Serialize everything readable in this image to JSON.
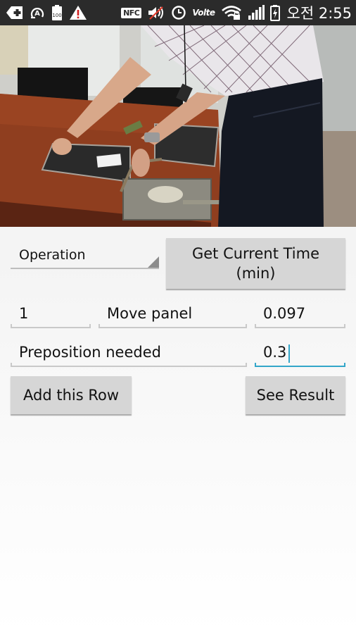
{
  "status_bar": {
    "left_icons": [
      "add-icon",
      "auto-rotate-icon",
      "battery-saver-100-icon",
      "warning-icon"
    ],
    "right_icons": [
      "nfc-icon",
      "mute-icon",
      "alarm-icon",
      "volte-icon",
      "wifi-lock-icon",
      "signal-icon",
      "charging-battery-icon"
    ],
    "nfc_label": "NFC",
    "volte_label": "Volte",
    "battery_saver_label": "100",
    "time": "오전 2:55"
  },
  "video": {
    "description": "Camera preview showing a person moving a panel on a wooden table"
  },
  "form": {
    "operation_spinner": {
      "selected": "Operation"
    },
    "get_time_button": {
      "line1": "Get Current Time",
      "line2": "(min)"
    },
    "row1": {
      "number": "1",
      "operation": "Move panel",
      "time": "0.097"
    },
    "row2": {
      "description": "Preposition needed",
      "value": "0.3"
    },
    "add_row_button": "Add this Row",
    "see_result_button": "See Result"
  },
  "colors": {
    "status_bar_bg": "#2b2b2b",
    "button_bg": "#d6d6d6",
    "focus_accent": "#33a6c9",
    "underline": "#c9c9c9"
  }
}
